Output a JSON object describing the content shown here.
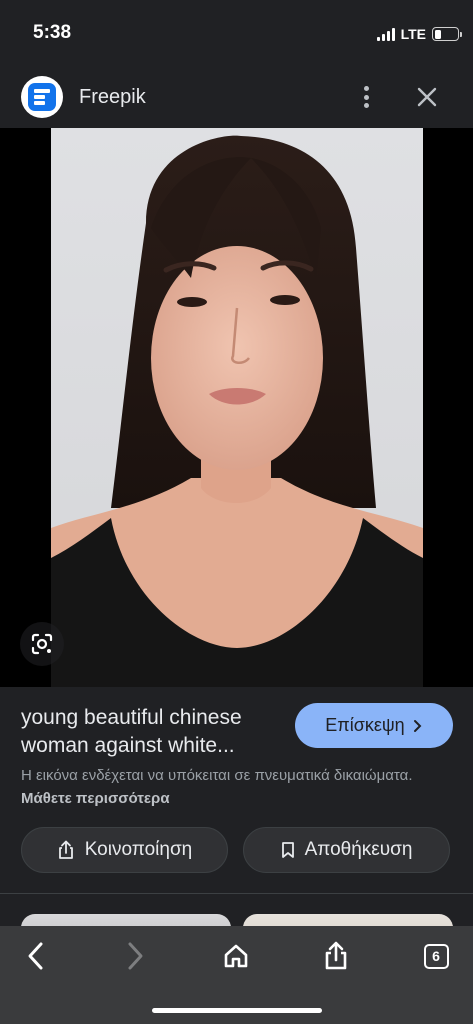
{
  "status_bar": {
    "time": "5:38",
    "network": "LTE",
    "battery_level": 0.3
  },
  "header": {
    "site_name": "Freepik",
    "logo_icon": "freepik-logo-icon",
    "menu_icon": "more-vert-icon",
    "close_icon": "close-icon"
  },
  "image": {
    "lens_icon": "google-lens-icon"
  },
  "info": {
    "title": "young beautiful chinese woman against white...",
    "visit_label": "Επίσκεψη",
    "copyright_text": "Η εικόνα ενδέχεται να υπόκειται σε πνευματικά δικαιώματα.",
    "learn_more": "Μάθετε περισσότερα",
    "share_label": "Κοινοποίηση",
    "save_label": "Αποθήκευση"
  },
  "bottom_bar": {
    "tab_count": "6"
  },
  "colors": {
    "background": "#202124",
    "accent": "#8ab4f8",
    "pill": "#303134",
    "toolbar": "#3a3b3d"
  }
}
